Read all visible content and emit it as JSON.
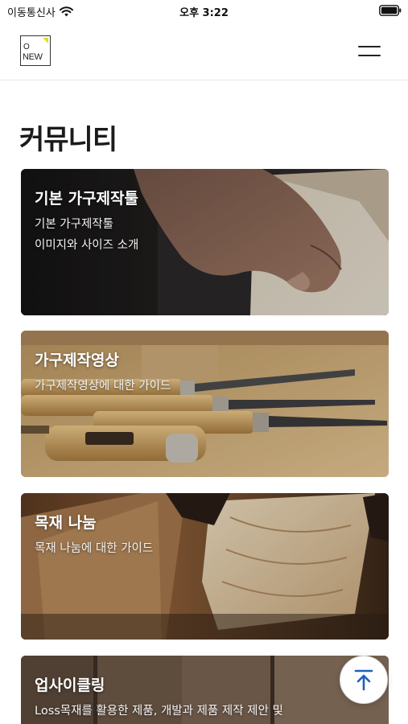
{
  "status_bar": {
    "carrier": "이동통신사",
    "time": "오후 3:22"
  },
  "header": {
    "logo_line1": "O",
    "logo_line2": "NEW"
  },
  "page": {
    "title": "커뮤니티"
  },
  "cards": [
    {
      "title": "기본 가구제작툴",
      "desc_lines": [
        "기본 가구제작툴",
        "이미지와 사이즈 소개"
      ]
    },
    {
      "title": "가구제작영상",
      "desc_lines": [
        "가구제작영상에 대한 가이드"
      ]
    },
    {
      "title": "목재 나눔",
      "desc_lines": [
        "목재 나눔에 대한 가이드"
      ]
    },
    {
      "title": "업사이클링",
      "desc_lines": [
        "Loss목재를 활용한 제품, 개발과 제품 제작 제안 및"
      ]
    }
  ],
  "icons": {
    "wifi": "wifi-icon",
    "battery": "battery-icon",
    "menu": "hamburger-menu-icon",
    "scroll_top": "arrow-up-to-top-icon"
  },
  "colors": {
    "accent": "#1f5fbf",
    "logo_mark": "#d9e21f"
  }
}
